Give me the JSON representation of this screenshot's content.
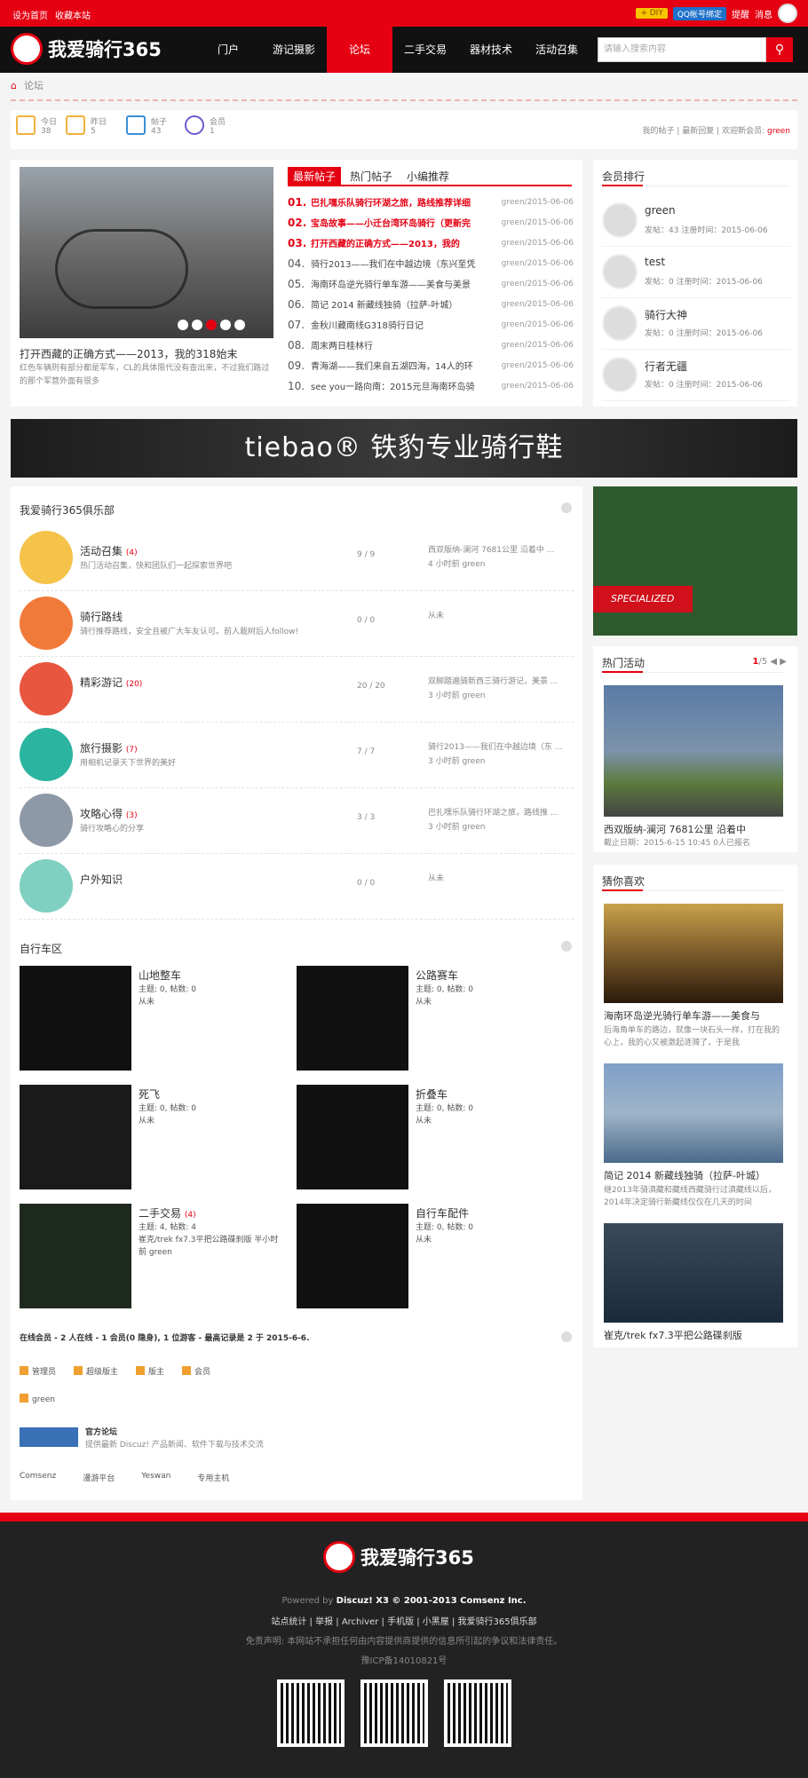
{
  "topbar": {
    "set_home": "设为首页",
    "bookmark": "收藏本站",
    "diy": "+ DIY",
    "qq_bind": "QQ帐号绑定",
    "remind": "提醒",
    "message": "消息"
  },
  "site": {
    "name": "我爱骑行365"
  },
  "nav": {
    "items": [
      "门户",
      "游记摄影",
      "论坛",
      "二手交易",
      "器材技术",
      "活动召集"
    ],
    "active": "论坛",
    "search_placeholder": "请输入搜索内容",
    "search_icon": "search-icon"
  },
  "breadcrumb": {
    "home_icon": "home-icon",
    "current": "论坛"
  },
  "stats": {
    "today_label": "今日",
    "today": "38",
    "yesterday_label": "昨日",
    "yesterday": "5",
    "posts_label": "帖子",
    "posts": "43",
    "members_label": "会员",
    "members": "1",
    "my_posts": "我的帖子",
    "latest_replies": "最新回复",
    "welcome": "欢迎新会员:",
    "new_member": "green"
  },
  "slideshow": {
    "title": "打开西藏的正确方式——2013，我的318始末",
    "desc": "红色车辆则有部分都是军车，CL的具体限代没有查出来，不过我们路过的那个军营外面有很多",
    "dots": 5,
    "active_dot": 3
  },
  "hot_tabs": {
    "tabs": [
      "最新帖子",
      "热门帖子",
      "小编推荐"
    ],
    "active": "最新帖子"
  },
  "threads": [
    {
      "num": "01.",
      "title": "巴扎嘿乐队骑行环湖之旅，路线推荐详细",
      "date": "green/2015-06-06",
      "hot": true
    },
    {
      "num": "02.",
      "title": "宝岛故事——小迁台湾环岛骑行（更新完",
      "date": "green/2015-06-06",
      "hot": true
    },
    {
      "num": "03.",
      "title": "打开西藏的正确方式——2013，我的",
      "date": "green/2015-06-06",
      "hot": true
    },
    {
      "num": "04.",
      "title": "骑行2013——我们在中越边境（东兴至凭",
      "date": "green/2015-06-06",
      "hot": false
    },
    {
      "num": "05.",
      "title": "海南环岛逆光骑行单车游——美食与美景",
      "date": "green/2015-06-06",
      "hot": false
    },
    {
      "num": "06.",
      "title": "简记 2014 新藏线独骑（拉萨-叶城）",
      "date": "green/2015-06-06",
      "hot": false
    },
    {
      "num": "07.",
      "title": "金秋川藏南线G318骑行日记",
      "date": "green/2015-06-06",
      "hot": false
    },
    {
      "num": "08.",
      "title": "周末两日桂林行",
      "date": "green/2015-06-06",
      "hot": false
    },
    {
      "num": "09.",
      "title": "青海湖——我们来自五湖四海，14人的环",
      "date": "green/2015-06-06",
      "hot": false
    },
    {
      "num": "10.",
      "title": "see you一路向南：2015元旦海南环岛骑",
      "date": "green/2015-06-06",
      "hot": false
    }
  ],
  "ranking": {
    "title": "会员排行",
    "members": [
      {
        "name": "green",
        "info": "发帖：43  注册时间：2015-06-06"
      },
      {
        "name": "test",
        "info": "发帖：0  注册时间：2015-06-06"
      },
      {
        "name": "骑行大神",
        "info": "发帖：0  注册时间：2015-06-06"
      },
      {
        "name": "行者无疆",
        "info": "发帖：0  注册时间：2015-06-06"
      }
    ]
  },
  "banner": {
    "text": "tiebao® 铁豹专业骑行鞋"
  },
  "club": {
    "title": "我爱骑行365俱乐部",
    "forums": [
      {
        "name": "活动召集",
        "badge": "(4)",
        "desc": "热门活动召集，快和团队们一起探索世界吧",
        "count": "9 / 9",
        "last": "西双版纳-澜河 7681公里 沿着中 ...",
        "last2": "4 小时前 green",
        "color": "#f5c24a"
      },
      {
        "name": "骑行路线",
        "badge": "",
        "desc": "骑行推荐路线，安全且被广大车友认可。前人栽树后人follow!",
        "count": "0 / 0",
        "last": "从未",
        "last2": "",
        "color": "#f07a3a"
      },
      {
        "name": "精彩游记",
        "badge": "(20)",
        "desc": "",
        "count": "20 / 20",
        "last": "双脚踏遍骑新西三骑行游记，美景 ...",
        "last2": "3 小时前 green",
        "color": "#e8563f"
      },
      {
        "name": "旅行摄影",
        "badge": "(7)",
        "desc": "用相机记录天下世界的美好",
        "count": "7 / 7",
        "last": "骑行2013——我们在中越边境（东 ...",
        "last2": "3 小时前 green",
        "color": "#2bb5a0"
      },
      {
        "name": "攻略心得",
        "badge": "(3)",
        "desc": "骑行攻略心的分享",
        "count": "3 / 3",
        "last": "巴扎嘿乐队骑行环湖之旅，路线推 ...",
        "last2": "3 小时前 green",
        "color": "#8d99a6"
      },
      {
        "name": "户外知识",
        "badge": "",
        "desc": "",
        "count": "0 / 0",
        "last": "从未",
        "last2": "",
        "color": "#7fd0c0"
      }
    ]
  },
  "cars": {
    "title": "自行车区",
    "items": [
      {
        "name": "山地整车",
        "badge": "",
        "info1": "主题: 0, 帖数: 0",
        "info2": "从未",
        "color": "#111"
      },
      {
        "name": "公路赛车",
        "badge": "",
        "info1": "主题: 0, 帖数: 0",
        "info2": "从未",
        "color": "#111"
      },
      {
        "name": "死飞",
        "badge": "",
        "info1": "主题: 0, 帖数: 0",
        "info2": "从未",
        "color": "#1a1a1a"
      },
      {
        "name": "折叠车",
        "badge": "",
        "info1": "主题: 0, 帖数: 0",
        "info2": "从未",
        "color": "#111"
      },
      {
        "name": "二手交易",
        "badge": "(4)",
        "info1": "主题: 4, 帖数: 4",
        "info2": "崔克/trek fx7.3平把公路碟刹版 半小时前 green",
        "color": "#1e2a1e"
      },
      {
        "name": "自行车配件",
        "badge": "",
        "info1": "主题: 0, 帖数: 0",
        "info2": "从未",
        "color": "#111"
      }
    ]
  },
  "online": {
    "text": "在线会员 - 2 人在线 - 1 会员(0 隐身), 1 位游客 - 最高记录是 2 于 2015-6-6.",
    "legend": [
      "管理员",
      "超级版主",
      "版主",
      "会员"
    ],
    "user": "green"
  },
  "official": {
    "title": "官方论坛",
    "desc": "提供最新 Discuz! 产品新闻、软件下载与技术交流"
  },
  "friend_links": [
    "Comsenz",
    "漫游平台",
    "Yeswan",
    "专用主机"
  ],
  "side_ad": {
    "brand": "SPECIALIZED"
  },
  "activity": {
    "title": "热门活动",
    "page": "1",
    "total": "/5",
    "item_title": "西双版纳-澜河 7681公里 沿着中",
    "item_sub": "截止日期：2015-6-15 10:45    0人已报名"
  },
  "guess": {
    "title": "猜你喜欢",
    "items": [
      {
        "title": "海南环岛逆光骑行单车游——美食与",
        "desc": "后海角单车的路边，就像一块石头一样，打在我的心上，我的心又被激起涟漪了，于是我"
      },
      {
        "title": "简记 2014 新藏线独骑（拉萨-叶城）",
        "desc": "继2013年骑滇藏和藏线西藏骑行过滇藏线以后，2014年决定骑行新藏线仅仅在几天的时间"
      },
      {
        "title": "崔克/trek fx7.3平把公路碟刹版",
        "desc": ""
      }
    ]
  },
  "footer": {
    "powered": "Powered by",
    "powered_b": "Discuz! X3 © 2001-2013 Comsenz Inc.",
    "links": "站点统计 | 举报 | Archiver | 手机版 | 小黑屋 | 我爱骑行365俱乐部",
    "disclaimer": "免责声明: 本网站不承担任何由内容提供商提供的信息所引起的争议和法律责任。",
    "icp": "豫ICP备14010821号"
  },
  "colors": {
    "accent": "#e50012",
    "dark": "#111111"
  }
}
